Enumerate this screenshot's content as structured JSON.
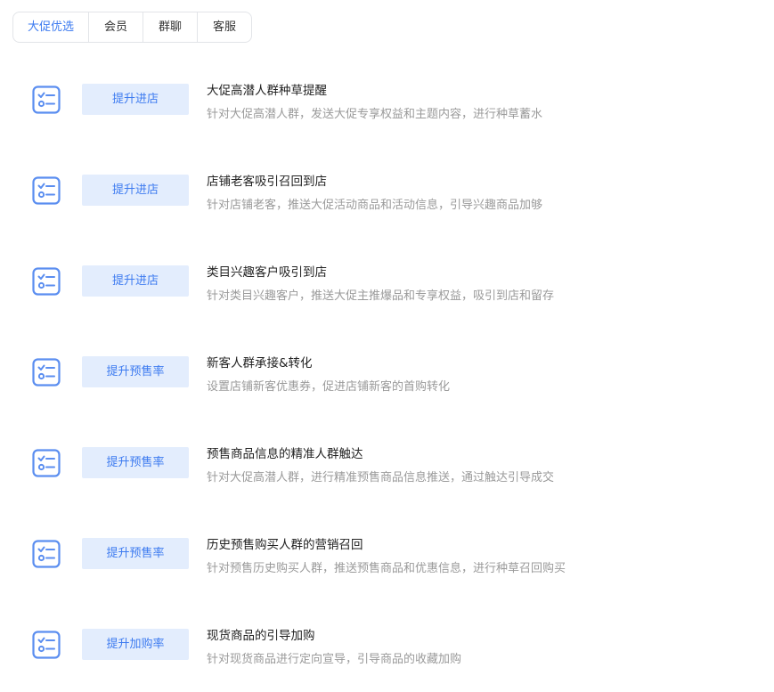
{
  "colors": {
    "accent": "#3d7bf0",
    "button_bg": "#e3edfd",
    "icon_stroke": "#5b8ef0",
    "desc_text": "#9a9a9a"
  },
  "tabs": [
    {
      "label": "大促优选",
      "active": true
    },
    {
      "label": "会员",
      "active": false
    },
    {
      "label": "群聊",
      "active": false
    },
    {
      "label": "客服",
      "active": false
    }
  ],
  "rows": [
    {
      "icon": "checklist-icon",
      "button": "提升进店",
      "title": "大促高潜人群种草提醒",
      "desc": "针对大促高潜人群，发送大促专享权益和主题内容，进行种草蓄水"
    },
    {
      "icon": "checklist-icon",
      "button": "提升进店",
      "title": "店铺老客吸引召回到店",
      "desc": "针对店铺老客，推送大促活动商品和活动信息，引导兴趣商品加够"
    },
    {
      "icon": "checklist-icon",
      "button": "提升进店",
      "title": "类目兴趣客户吸引到店",
      "desc": "针对类目兴趣客户，推送大促主推爆品和专享权益，吸引到店和留存"
    },
    {
      "icon": "checklist-icon",
      "button": "提升预售率",
      "title": "新客人群承接&转化",
      "desc": "设置店铺新客优惠券，促进店铺新客的首购转化"
    },
    {
      "icon": "checklist-icon",
      "button": "提升预售率",
      "title": "预售商品信息的精准人群触达",
      "desc": "针对大促高潜人群，进行精准预售商品信息推送，通过触达引导成交"
    },
    {
      "icon": "checklist-icon",
      "button": "提升预售率",
      "title": "历史预售购买人群的营销召回",
      "desc": "针对预售历史购买人群，推送预售商品和优惠信息，进行种草召回购买"
    },
    {
      "icon": "checklist-icon",
      "button": "提升加购率",
      "title": "现货商品的引导加购",
      "desc": "针对现货商品进行定向宣导，引导商品的收藏加购"
    }
  ]
}
